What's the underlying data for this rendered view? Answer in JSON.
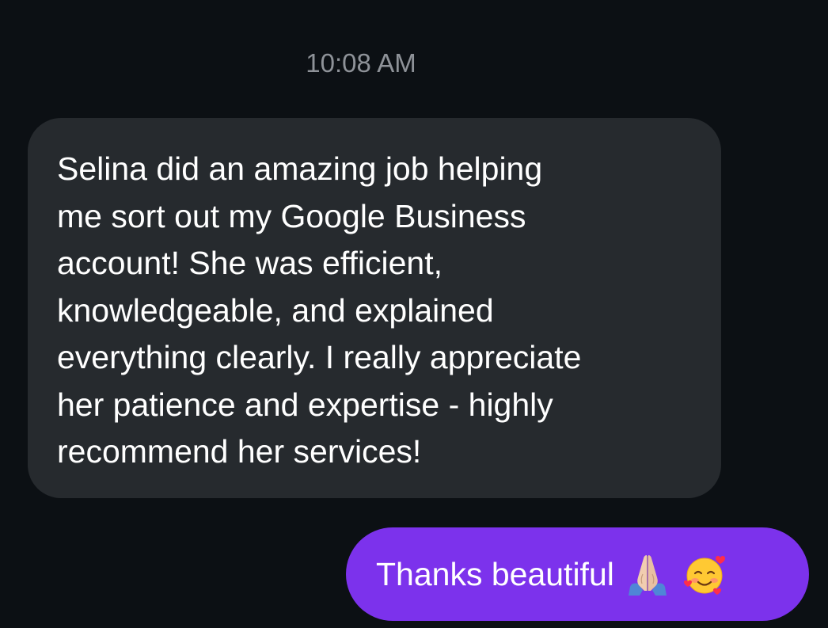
{
  "conversation": {
    "timestamp": "10:08 AM",
    "incoming_message": {
      "text": "Selina did an amazing job helping\nme sort out my Google Business\naccount! She was efficient,\nknowledgeable, and explained\neverything clearly. I really appreciate\nher patience and expertise - highly\nrecommend her services!"
    },
    "outgoing_message": {
      "text": "Thanks beautiful",
      "emojis": [
        "folded-hands-emoji",
        "smiling-face-with-hearts-emoji"
      ]
    }
  },
  "colors": {
    "background": "#0c1014",
    "incoming_bubble": "#262a2e",
    "outgoing_bubble": "#7c32ec",
    "timestamp_text": "#8e9298",
    "message_text": "#ffffff"
  }
}
